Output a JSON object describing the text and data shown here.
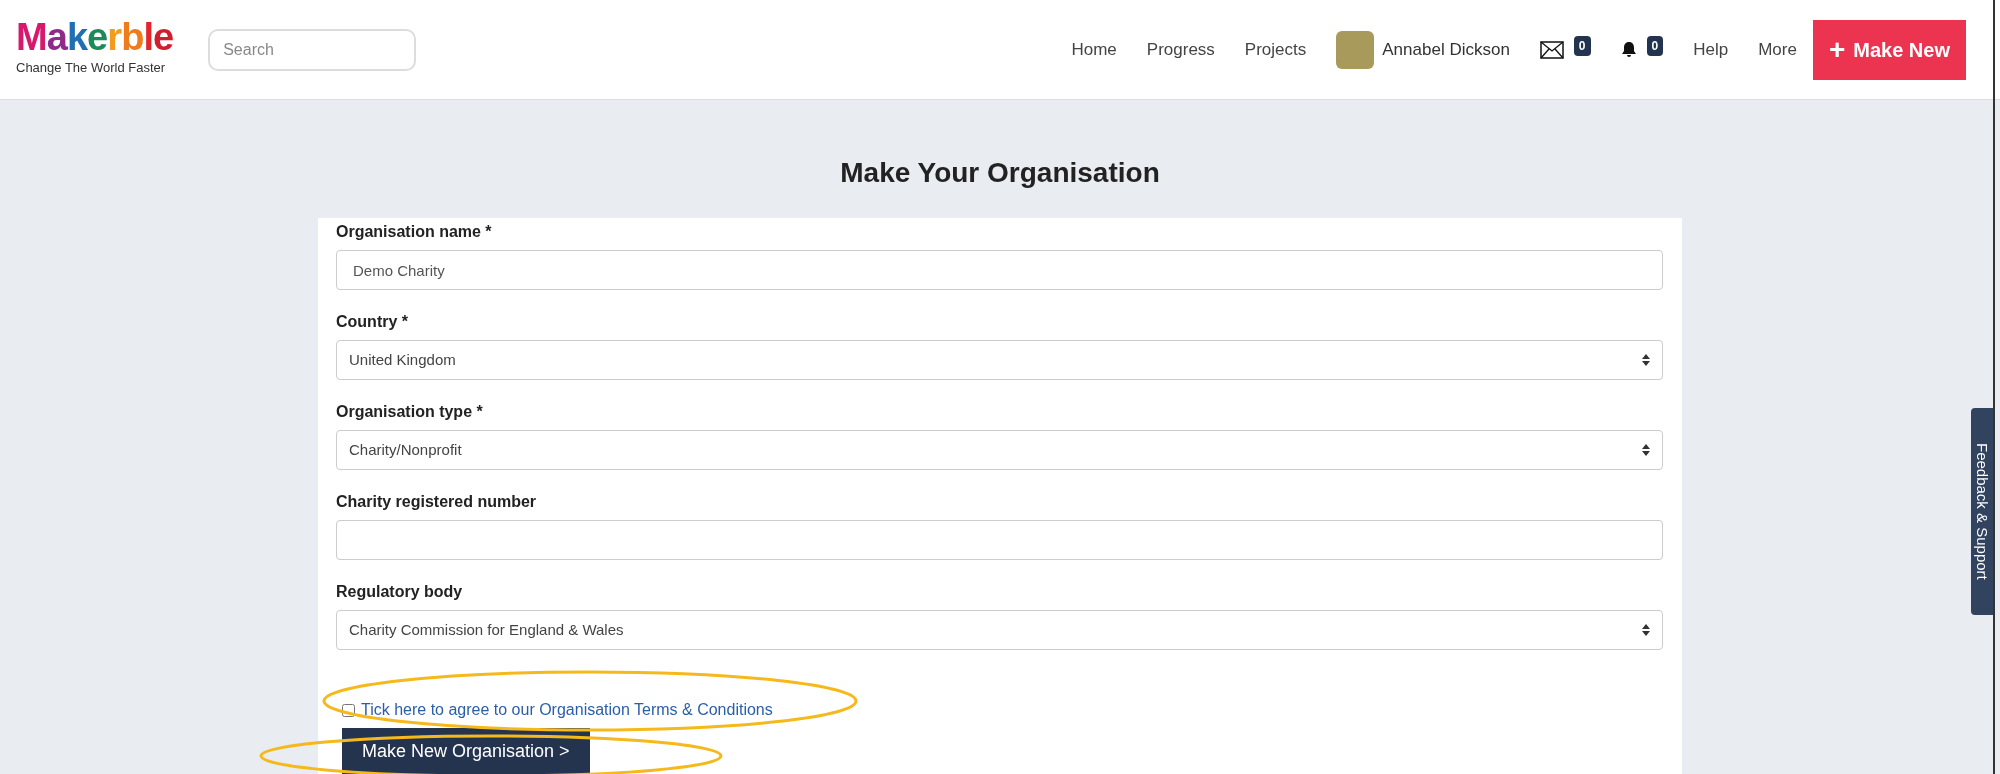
{
  "header": {
    "logo": "Makerble",
    "tagline": "Change The World Faster",
    "search": {
      "placeholder": "Search"
    },
    "nav": [
      {
        "kind": "link",
        "label": "Home"
      },
      {
        "kind": "link",
        "label": "Progress"
      },
      {
        "kind": "link",
        "label": "Projects"
      },
      {
        "kind": "user",
        "label": "Annabel Dickson"
      },
      {
        "kind": "messages",
        "count": "0"
      },
      {
        "kind": "notifications",
        "count": "0"
      },
      {
        "kind": "link",
        "label": "Help"
      },
      {
        "kind": "link",
        "label": "More"
      }
    ],
    "make_new": {
      "icon": "+",
      "label": "Make New"
    }
  },
  "title": "Make Your Organisation",
  "fields": [
    {
      "kind": "text",
      "label": "Organisation name *",
      "value": "Demo Charity"
    },
    {
      "kind": "select",
      "label": "Country *",
      "value": "United Kingdom"
    },
    {
      "kind": "select",
      "label": "Organisation type *",
      "value": "Charity/Nonprofit"
    },
    {
      "kind": "text",
      "label": "Charity registered number"
    },
    {
      "kind": "select",
      "label": "Regulatory body",
      "value": "Charity Commission for England & Wales"
    }
  ],
  "terms": {
    "label": "Tick here to agree to our Organisation Terms & Conditions",
    "checked": false
  },
  "submit": "Make New Organisation >",
  "feedback_tab": "Feedback & Support"
}
